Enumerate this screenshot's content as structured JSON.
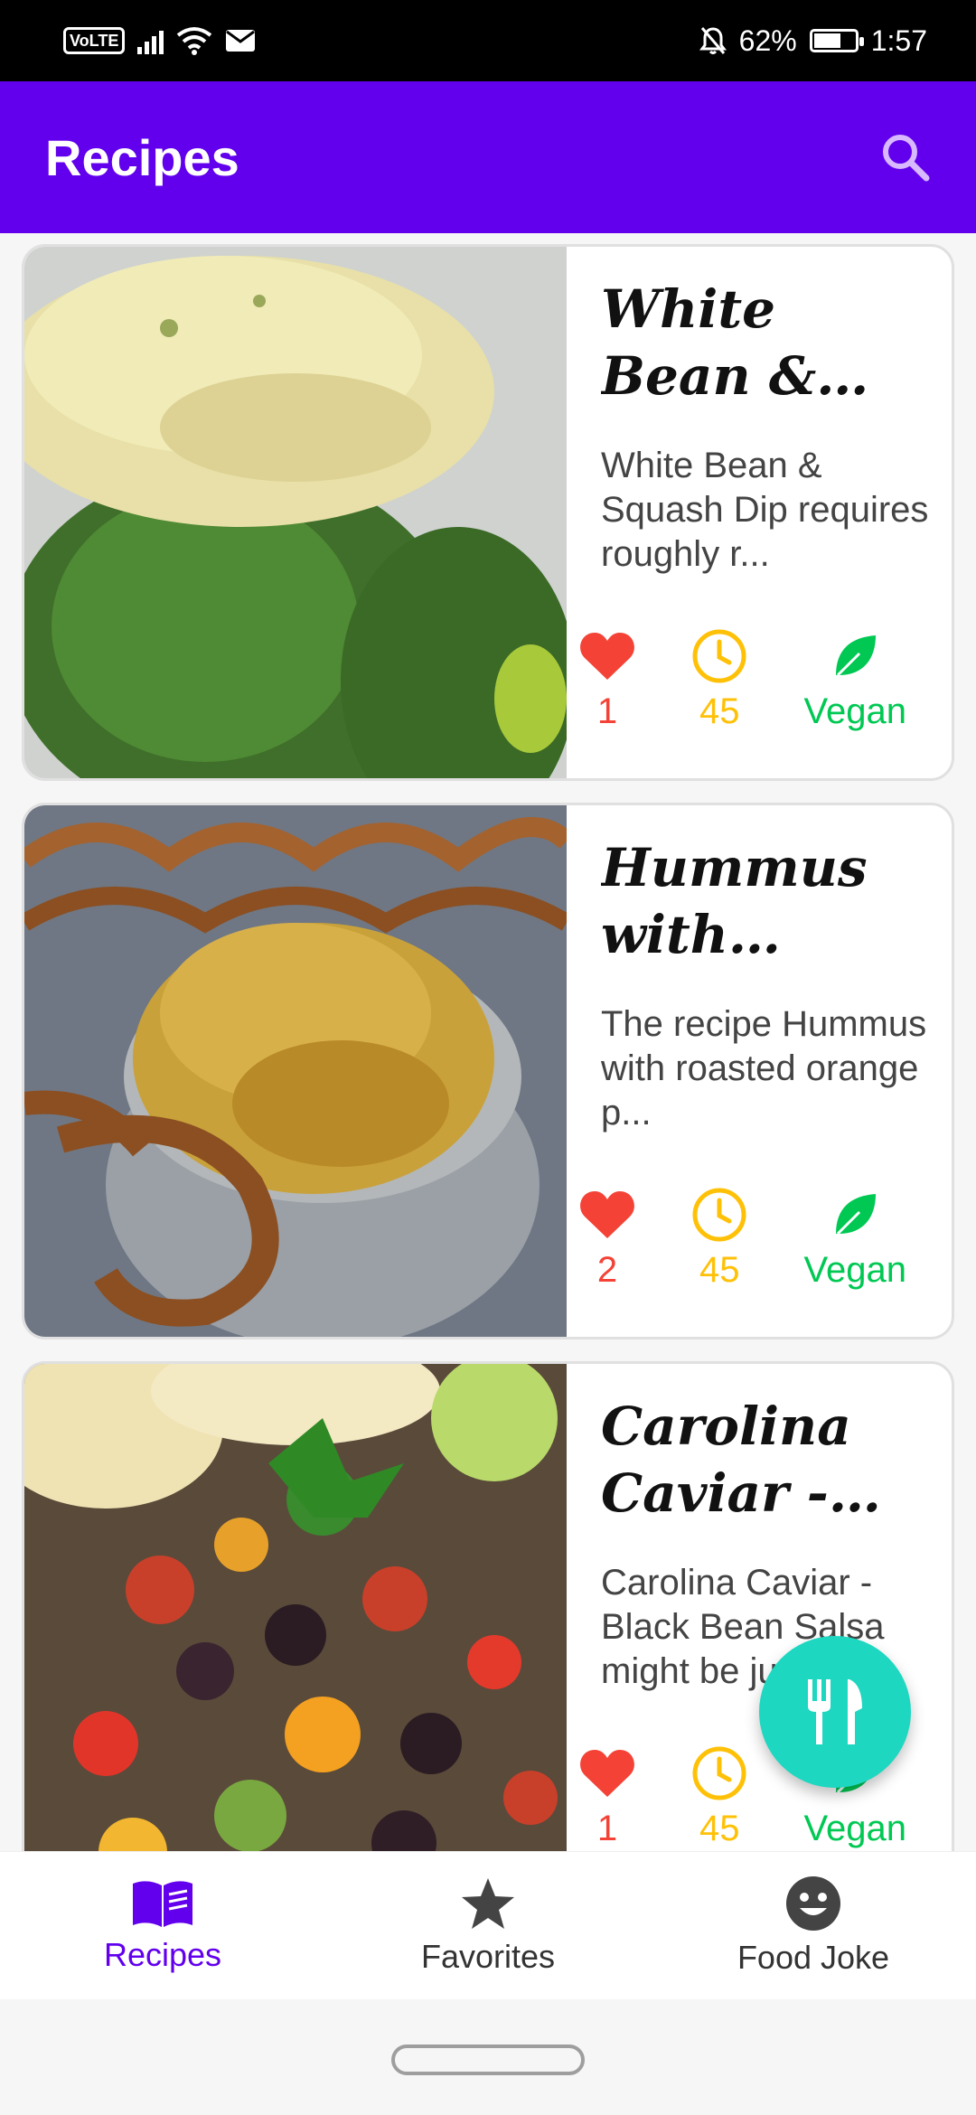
{
  "status_bar": {
    "network": "VoLTE",
    "battery": "62%",
    "time": "1:57"
  },
  "app_bar": {
    "title": "Recipes"
  },
  "recipes": [
    {
      "title": "White Bean & Squash Dip",
      "description": "White Bean & Squash Dip requires roughly r...",
      "likes": "1",
      "minutes": "45",
      "diet": "Vegan"
    },
    {
      "title": "Hummus with roaste...",
      "description": "The recipe Hummus with roasted orange p...",
      "likes": "2",
      "minutes": "45",
      "diet": "Vegan"
    },
    {
      "title": "Carolina Caviar - Bl...",
      "description": "Carolina Caviar - Black Bean Salsa might be ju...",
      "likes": "1",
      "minutes": "45",
      "diet": "Vegan"
    }
  ],
  "bottom_nav": [
    {
      "label": "Recipes",
      "icon": "book-icon",
      "active": true
    },
    {
      "label": "Favorites",
      "icon": "star-icon",
      "active": false
    },
    {
      "label": "Food Joke",
      "icon": "smiley-icon",
      "active": false
    }
  ],
  "colors": {
    "primary": "#6200EE",
    "fab": "#1DD7C1",
    "likes": "#F44336",
    "time": "#FFC107",
    "vegan": "#00C853"
  }
}
